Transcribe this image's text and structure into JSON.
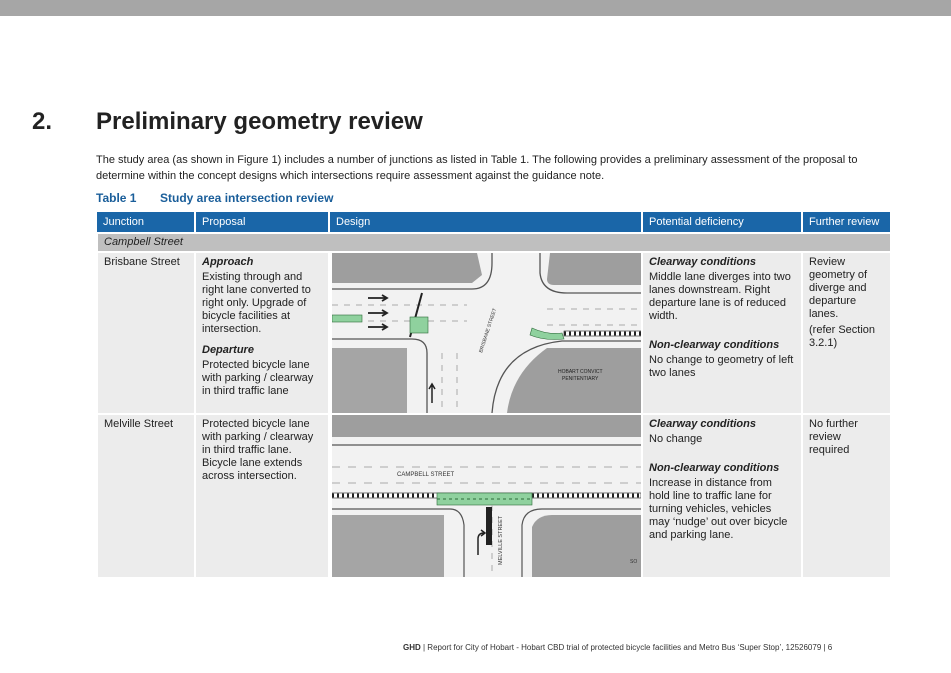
{
  "section": {
    "number": "2.",
    "title": "Preliminary geometry review",
    "intro": "The study area (as shown in Figure 1) includes a number of junctions as listed in Table 1. The following provides a preliminary assessment of the proposal to determine within the concept designs which intersections require assessment against the guidance note."
  },
  "table": {
    "caption_label": "Table 1",
    "caption_title": "Study area intersection review",
    "headers": [
      "Junction",
      "Proposal",
      "Design",
      "Potential deficiency",
      "Further review"
    ],
    "subheader": "Campbell Street",
    "rows": [
      {
        "junction": "Brisbane Street",
        "proposal_approach_title": "Approach",
        "proposal_approach_text": "Existing through and right lane converted to right only. Upgrade of bicycle facilities at intersection.",
        "proposal_departure_title": "Departure",
        "proposal_departure_text": "Protected bicycle lane with parking / clearway in third traffic lane",
        "deficiency_a_title": "Clearway conditions",
        "deficiency_a_text": "Middle lane diverges into two lanes downstream. Right departure lane is of reduced width.",
        "deficiency_b_title": "Non-clearway conditions",
        "deficiency_b_text": "No change to geometry of left two lanes",
        "further_review_1": "Review geometry of diverge and departure lanes.",
        "further_review_2": "(refer Section 3.2.1)",
        "map_labels": {
          "street": "BRISBANE STREET",
          "building_1": "HOBART CONVICT",
          "building_2": "PENITENTIARY"
        }
      },
      {
        "junction": "Melville Street",
        "proposal_text": "Protected bicycle lane with parking / clearway in third traffic lane. Bicycle lane extends across intersection.",
        "deficiency_a_title": "Clearway conditions",
        "deficiency_a_text": "No change",
        "deficiency_b_title": "Non-clearway conditions",
        "deficiency_b_text": "Increase in distance from hold line to traffic lane for turning vehicles, vehicles may ‘nudge’ out over bicycle and parking lane.",
        "further_review": "No further review required",
        "map_labels": {
          "street_h": "CAMPBELL STREET",
          "street_v": "MELVILLE STREET",
          "corner": "SO"
        }
      }
    ]
  },
  "footer": {
    "brand": "GHD",
    "text": " | Report for City of Hobart - Hobart CBD trial of protected bicycle facilities and Metro Bus ‘Super Stop’, 12526079 | 6"
  },
  "colors": {
    "header_blue": "#1a66a8",
    "caption_blue": "#1a5e9a",
    "bike_lane_green": "#8fd19e",
    "cell_grey": "#ececec"
  }
}
